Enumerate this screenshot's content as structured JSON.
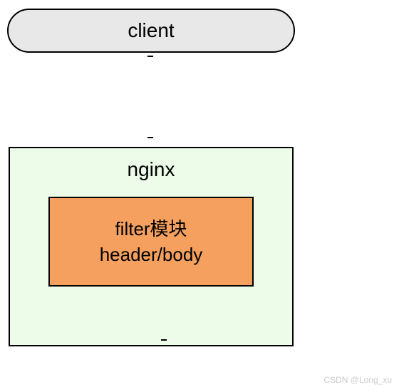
{
  "diagram": {
    "client_label": "client",
    "nginx_label": "nginx",
    "filter_line1": "filter模块",
    "filter_line2": "header/body"
  },
  "watermark": "CSDN @Long_xu",
  "colors": {
    "client_bg": "#e8e8e8",
    "nginx_bg": "#ecfce9",
    "filter_bg": "#f5a05e",
    "border": "#000000"
  }
}
